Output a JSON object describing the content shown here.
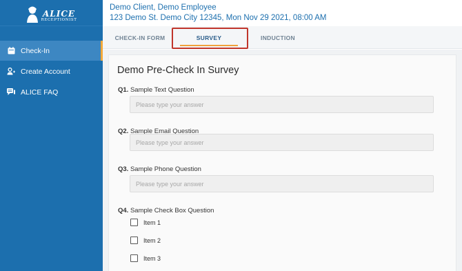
{
  "brand": {
    "name": "ALICE",
    "tagline": "RECEPTIONIST"
  },
  "sidebar": {
    "items": [
      {
        "label": "Check-In",
        "icon": "calendar-icon",
        "active": true
      },
      {
        "label": "Create Account",
        "icon": "user-add-icon",
        "active": false
      },
      {
        "label": "ALICE FAQ",
        "icon": "chat-icon",
        "active": false
      }
    ]
  },
  "header": {
    "client_line": "Demo Client, Demo Employee",
    "address_line": "123 Demo St. Demo City 12345, Mon Nov 29 2021, 08:00 AM"
  },
  "tabs": [
    {
      "label": "CHECK-IN FORM",
      "active": false
    },
    {
      "label": "SURVEY",
      "active": true
    },
    {
      "label": "INDUCTION",
      "active": false
    }
  ],
  "survey": {
    "title": "Demo Pre-Check In Survey",
    "questions": [
      {
        "number": "Q1.",
        "text": "Sample Text Question",
        "placeholder": "Please type your answer"
      },
      {
        "number": "Q2.",
        "text": "Sample Email Question",
        "placeholder": "Please type your answer"
      },
      {
        "number": "Q3.",
        "text": "Sample Phone Question",
        "placeholder": "Please type your answer"
      },
      {
        "number": "Q4.",
        "text": "Sample Check Box Question",
        "options": [
          "Item 1",
          "Item 2",
          "Item 3"
        ]
      }
    ]
  },
  "colors": {
    "sidebar": "#1c6fae",
    "sidebar_active": "#3d87c2",
    "accent": "#f0a03a",
    "header_text": "#1c6fae",
    "highlight_box": "#c0352b"
  }
}
